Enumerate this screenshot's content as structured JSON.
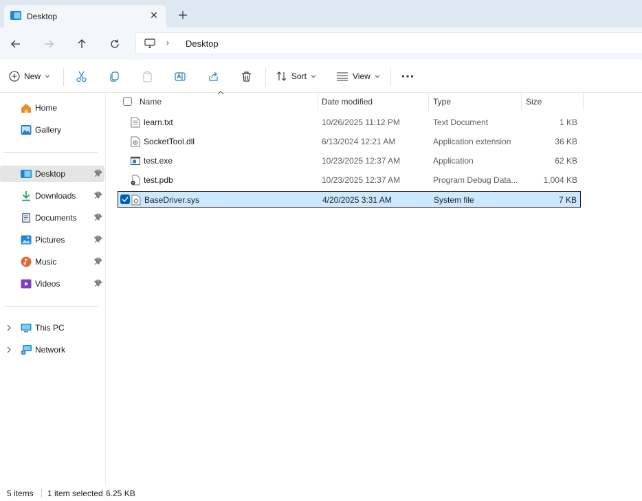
{
  "window": {
    "tab_title": "Desktop",
    "close_glyph": "✕",
    "new_tab_glyph": "+"
  },
  "address": {
    "crumbs": [
      "Desktop"
    ],
    "separator": "›"
  },
  "toolbar": {
    "new_label": "New",
    "sort_label": "Sort",
    "view_label": "View",
    "more_glyph": "···"
  },
  "sidebar": {
    "quick": [
      {
        "label": "Home",
        "icon": "home-icon"
      },
      {
        "label": "Gallery",
        "icon": "gallery-icon"
      }
    ],
    "pinned": [
      {
        "label": "Desktop",
        "icon": "desktop-icon",
        "selected": true
      },
      {
        "label": "Downloads",
        "icon": "downloads-icon"
      },
      {
        "label": "Documents",
        "icon": "documents-icon"
      },
      {
        "label": "Pictures",
        "icon": "pictures-icon"
      },
      {
        "label": "Music",
        "icon": "music-icon"
      },
      {
        "label": "Videos",
        "icon": "videos-icon"
      }
    ],
    "locations": [
      {
        "label": "This PC",
        "icon": "this-pc-icon"
      },
      {
        "label": "Network",
        "icon": "network-icon"
      }
    ]
  },
  "columns": {
    "name": "Name",
    "date": "Date modified",
    "type": "Type",
    "size": "Size"
  },
  "files": [
    {
      "name": "learn.txt",
      "date": "10/26/2025 11:12 PM",
      "type": "Text Document",
      "size": "1 KB",
      "icon": "text-file-icon",
      "selected": false
    },
    {
      "name": "SocketTool.dll",
      "date": "6/13/2024 12:21 AM",
      "type": "Application extension",
      "size": "36 KB",
      "icon": "dll-file-icon",
      "selected": false
    },
    {
      "name": "test.exe",
      "date": "10/23/2025 12:37 AM",
      "type": "Application",
      "size": "62 KB",
      "icon": "exe-file-icon",
      "selected": false
    },
    {
      "name": "test.pdb",
      "date": "10/23/2025 12:37 AM",
      "type": "Program Debug Data...",
      "size": "1,004 KB",
      "icon": "pdb-file-icon",
      "selected": false
    },
    {
      "name": "BaseDriver.sys",
      "date": "4/20/2025 3:31 AM",
      "type": "System file",
      "size": "7 KB",
      "icon": "sys-file-icon",
      "selected": true
    }
  ],
  "status": {
    "item_count": "5 items",
    "selection": "1 item selected",
    "selection_size": "6.25 KB"
  },
  "colors": {
    "accent": "#005fb8",
    "selection_bg": "#cce8ff",
    "titlebar_bg": "#dfe7f1"
  }
}
